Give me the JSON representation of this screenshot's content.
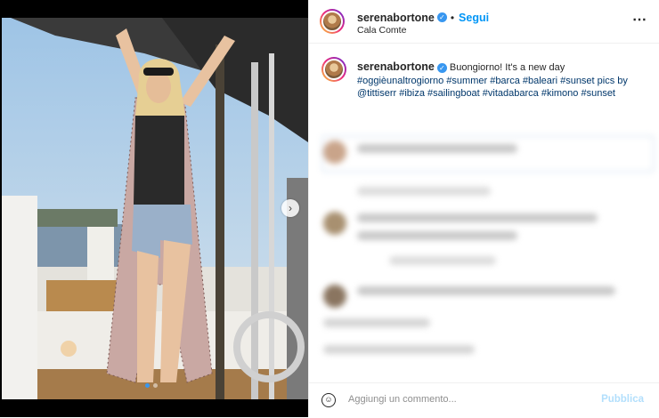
{
  "post": {
    "username": "serenabortone",
    "separator": "•",
    "follow_label": "Segui",
    "location": "Cala Comte",
    "more_icon": "⋯",
    "caption_user": "serenabortone",
    "caption_text": "Buongiorno! It's a new day",
    "caption_hashtags": "#oggièunaltrogiorno #summer #barca #baleari #sunset pics by @tittiserr #ibiza #sailingboat #vitadabarca #kimono #sunset"
  },
  "media": {
    "next_icon": "›",
    "slide_count": 2,
    "active_slide": 1
  },
  "comment_box": {
    "placeholder": "Aggiungi un commento...",
    "publish_label": "Pubblica"
  },
  "colors": {
    "accent": "#0095f6",
    "hashtag": "#00376b",
    "verified": "#3897f0"
  }
}
